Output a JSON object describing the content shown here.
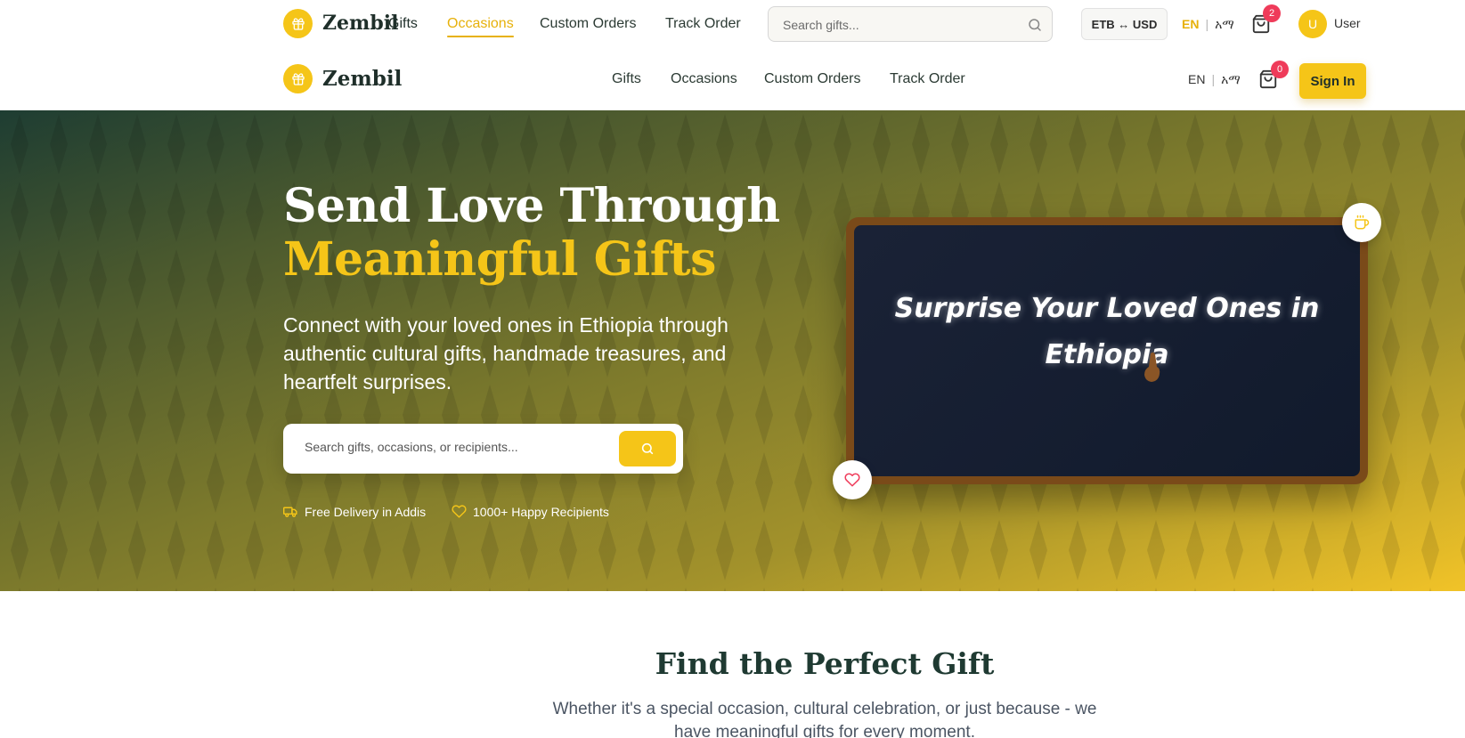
{
  "header_top": {
    "brand": "Zembil",
    "brand_suffix": "Gifts",
    "nav": [
      {
        "label": "Occasions",
        "active": true
      },
      {
        "label": "Custom Orders",
        "active": false
      },
      {
        "label": "Track Order",
        "active": false
      }
    ],
    "search_placeholder": "Search gifts...",
    "currency_toggle": "ETB ↔ USD",
    "lang_en": "EN",
    "lang_am": "አማ",
    "cart_count": "2",
    "avatar_initial": "U",
    "user_label": "User"
  },
  "header_main": {
    "brand": "Zembil",
    "nav": [
      "Gifts",
      "Occasions",
      "Custom Orders",
      "Track Order"
    ],
    "lang_en": "EN",
    "lang_am": "አማ",
    "cart_count": "0",
    "signin_label": "Sign In"
  },
  "hero": {
    "title_line1": "Send Love Through",
    "title_line2": "Meaningful Gifts",
    "subtitle": "Connect with your loved ones in Ethiopia through authentic cultural gifts, handmade treasures, and heartfelt surprises.",
    "search_placeholder": "Search gifts, occasions, or recipients...",
    "perks": [
      "Free Delivery in Addis",
      "1000+ Happy Recipients"
    ],
    "board_text": "Surprise Your Loved Ones in Ethiopia"
  },
  "section": {
    "title": "Find the Perfect Gift",
    "subtitle": "Whether it's a special occasion, cultural celebration, or just because - we have meaningful gifts for every moment."
  },
  "colors": {
    "accent": "#f5c518",
    "accent_text": "#e7b10a",
    "brand_dark": "#1f2f2a",
    "badge": "#ef3b5a"
  }
}
